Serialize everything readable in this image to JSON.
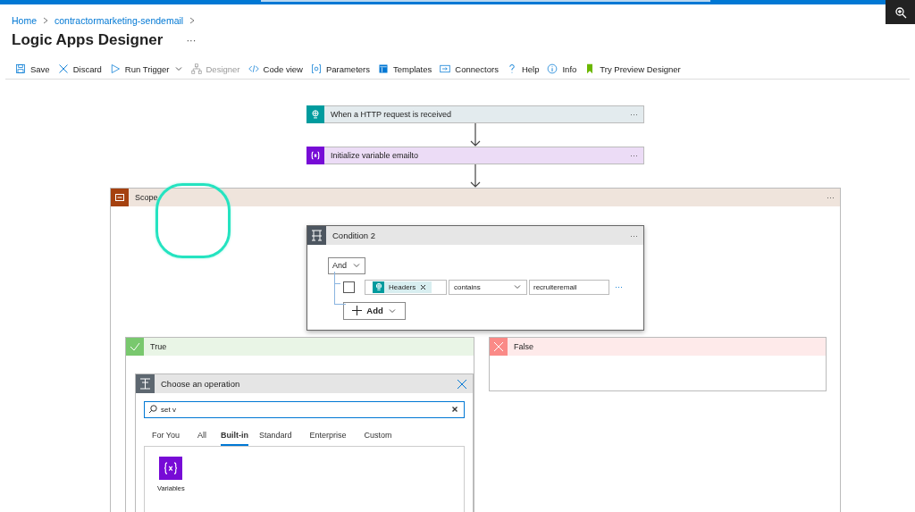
{
  "breadcrumb": [
    {
      "label": "Home"
    },
    {
      "label": "contractormarketing-sendemail"
    }
  ],
  "title": "Logic Apps Designer",
  "title_menu": "···",
  "toolbar": [
    {
      "label": "Save",
      "disabled": false,
      "dropdown": false
    },
    {
      "label": "Discard",
      "disabled": false,
      "dropdown": false
    },
    {
      "label": "Run Trigger",
      "disabled": false,
      "dropdown": true
    },
    {
      "label": "Designer",
      "disabled": true,
      "dropdown": false
    },
    {
      "label": "Code view",
      "disabled": false,
      "dropdown": false
    },
    {
      "label": "Parameters",
      "disabled": false,
      "dropdown": false
    },
    {
      "label": "Templates",
      "disabled": false,
      "dropdown": false
    },
    {
      "label": "Connectors",
      "disabled": false,
      "dropdown": false
    },
    {
      "label": "Help",
      "disabled": false,
      "dropdown": false
    },
    {
      "label": "Info",
      "disabled": false,
      "dropdown": false
    },
    {
      "label": "Try Preview Designer",
      "disabled": false,
      "dropdown": false
    }
  ],
  "steps": [
    {
      "kind": "trigger",
      "title": "When a HTTP request is received",
      "menu": "···"
    },
    {
      "kind": "variable",
      "title": "Initialize variable emailto",
      "menu": "···"
    }
  ],
  "scope": {
    "title": "Scope",
    "menu": "···",
    "condition": {
      "title": "Condition 2",
      "menu": "···",
      "group_operator": "And",
      "rows": [
        {
          "checked": false,
          "token": "Headers",
          "operator": "contains",
          "value": "recruiteremail",
          "menu": "···"
        }
      ],
      "add_label": "Add"
    },
    "branches": [
      {
        "kind": "true",
        "title": "True"
      },
      {
        "kind": "false",
        "title": "False"
      }
    ]
  },
  "picker": {
    "title": "Choose an operation",
    "search_value": "set v",
    "tabs": [
      {
        "label": "For You",
        "selected": false
      },
      {
        "label": "All",
        "selected": false
      },
      {
        "label": "Built-in",
        "selected": true
      },
      {
        "label": "Standard",
        "selected": false
      },
      {
        "label": "Enterprise",
        "selected": false
      },
      {
        "label": "Custom",
        "selected": false
      }
    ],
    "results": [
      {
        "label": "Variables"
      }
    ]
  }
}
